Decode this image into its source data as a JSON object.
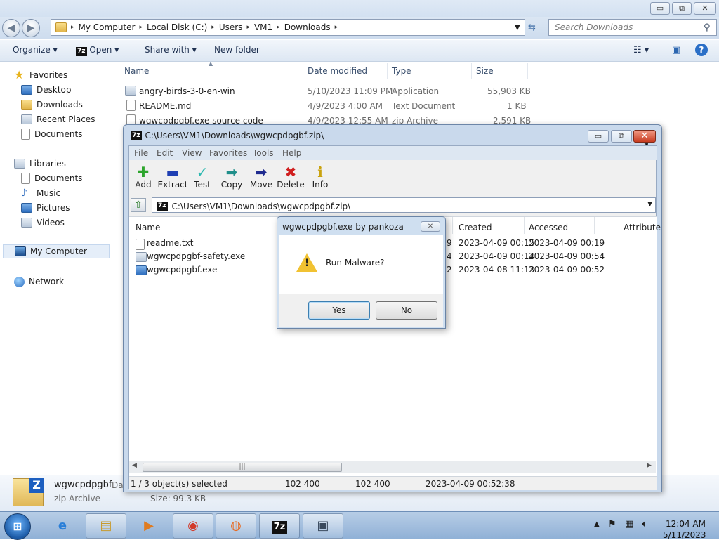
{
  "explorer": {
    "title_buttons": {
      "minimize": "▭",
      "maximize": "⧉",
      "close": "✕"
    },
    "address": {
      "segments": [
        "My Computer",
        "Local Disk (C:)",
        "Users",
        "VM1",
        "Downloads"
      ],
      "separator": "▸"
    },
    "search_placeholder": "Search Downloads",
    "toolbar": {
      "organize": "Organize ▾",
      "open": "Open ▾",
      "share": "Share with ▾",
      "new_folder": "New folder"
    },
    "nav": {
      "favorites": "Favorites",
      "desktop": "Desktop",
      "downloads": "Downloads",
      "recent_places": "Recent Places",
      "documents": "Documents",
      "libraries": "Libraries",
      "lib_documents": "Documents",
      "music": "Music",
      "pictures": "Pictures",
      "videos": "Videos",
      "my_computer": "My Computer",
      "network": "Network"
    },
    "columns": {
      "name": "Name",
      "date_modified": "Date modified",
      "type": "Type",
      "size": "Size"
    },
    "files": [
      {
        "name": "angry-birds-3-0-en-win",
        "date": "5/10/2023 11:09 PM",
        "type": "Application",
        "size": "55,903 KB"
      },
      {
        "name": "README.md",
        "date": "4/9/2023 4:00 AM",
        "type": "Text Document",
        "size": "1 KB"
      },
      {
        "name": "wgwcpdpgbf.exe source code",
        "date": "4/9/2023 12:55 AM",
        "type": "zip Archive",
        "size": "2,591 KB"
      }
    ],
    "details": {
      "name": "wgwcpdpgbf",
      "date_label": "Dat",
      "type": "zip Archive",
      "size": "Size: 99.3 KB"
    }
  },
  "zip": {
    "title": "C:\\Users\\VM1\\Downloads\\wgwcpdpgbf.zip\\",
    "logo": "7z",
    "menu": [
      "File",
      "Edit",
      "View",
      "Favorites",
      "Tools",
      "Help"
    ],
    "tools": {
      "add": "Add",
      "extract": "Extract",
      "test": "Test",
      "copy": "Copy",
      "move": "Move",
      "delete": "Delete",
      "info": "Info"
    },
    "path": "C:\\Users\\VM1\\Downloads\\wgwcpdpgbf.zip\\",
    "columns": {
      "name": "Name",
      "created": "Created",
      "accessed": "Accessed",
      "attributes": "Attribute"
    },
    "rows": [
      {
        "name": "readme.txt",
        "partial": "9",
        "created": "2023-04-09 00:15",
        "accessed": "2023-04-09 00:19"
      },
      {
        "name": "wgwcpdpgbf-safety.exe",
        "partial": "4",
        "created": "2023-04-09 00:14",
        "accessed": "2023-04-09 00:54"
      },
      {
        "name": "wgwcpdpgbf.exe",
        "partial": "2",
        "created": "2023-04-08 11:13",
        "accessed": "2023-04-09 00:52"
      }
    ],
    "status": {
      "selected": "1 / 3 object(s) selected",
      "size": "102 400",
      "packed": "102 400",
      "modified": "2023-04-09 00:52:38"
    }
  },
  "dialog": {
    "title": "wgwcpdpgbf.exe by pankoza",
    "message": "Run Malware?",
    "yes": "Yes",
    "no": "No"
  },
  "taskbar": {
    "time": "12:04 AM",
    "date": "5/11/2023",
    "apps": [
      "start-orb",
      "internet-explorer",
      "file-explorer",
      "media-player",
      "chrome",
      "firefox",
      "7-zip",
      "malware-app"
    ]
  }
}
